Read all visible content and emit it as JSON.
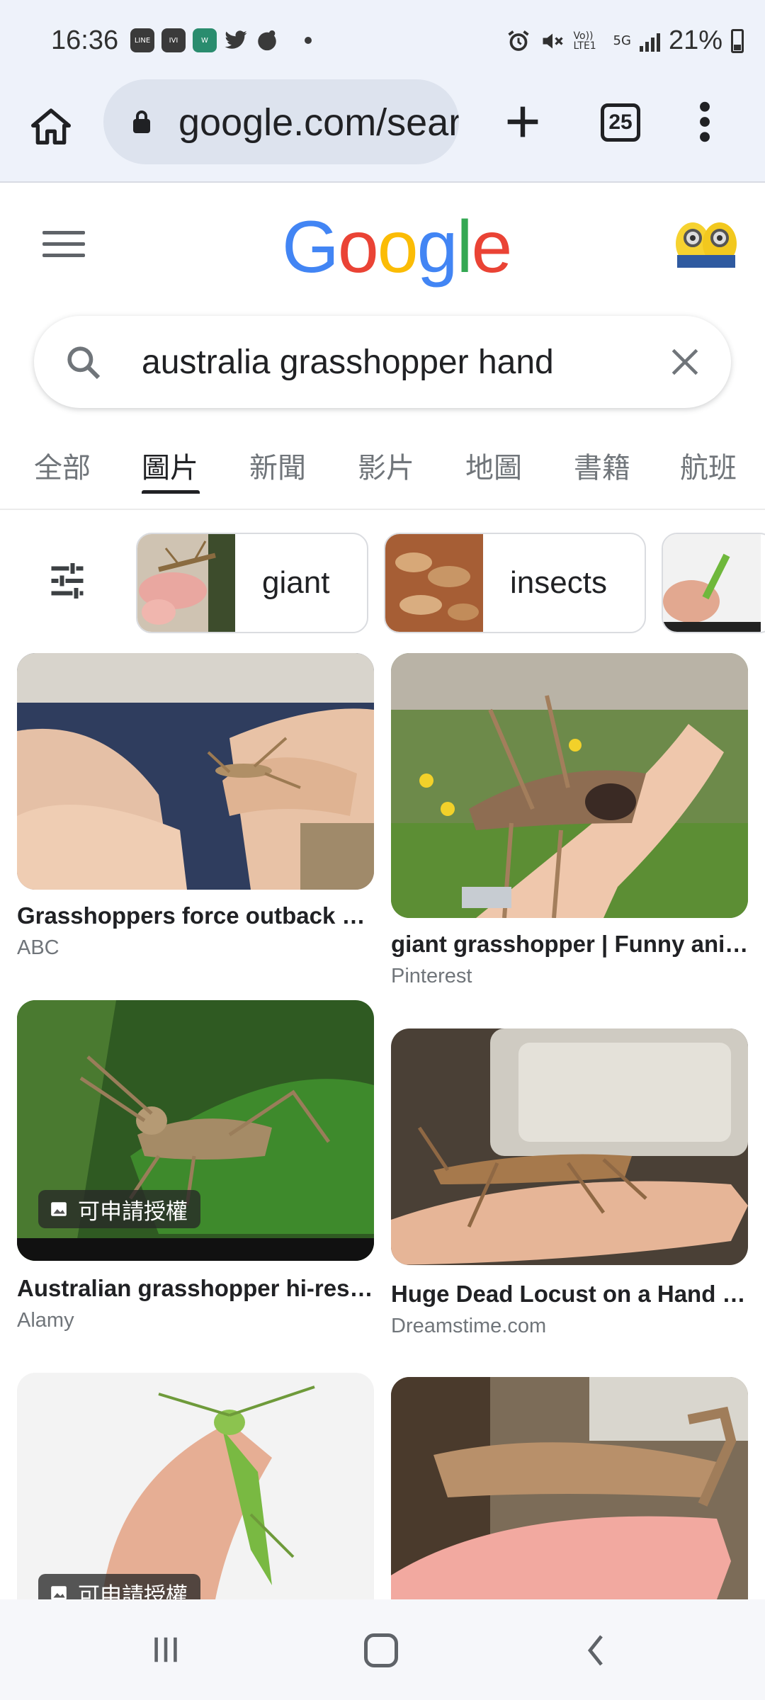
{
  "status_bar": {
    "time": "16:36",
    "app_icons": [
      "line-icon",
      "msg-app-icon",
      "webtoon-icon",
      "twitter-icon",
      "app-icon"
    ],
    "volte": "Vo)) LTE1",
    "network": "5G",
    "battery": "21%"
  },
  "browser": {
    "url": "google.com/search?q=australia",
    "tab_count": "25"
  },
  "google": {
    "logo_letters": [
      "G",
      "o",
      "o",
      "g",
      "l",
      "e"
    ],
    "logo_colors": [
      "#4285F4",
      "#EA4335",
      "#FBBC05",
      "#4285F4",
      "#34A853",
      "#EA4335"
    ]
  },
  "search": {
    "query": "australia grasshopper hand"
  },
  "tabs": [
    "全部",
    "圖片",
    "新聞",
    "影片",
    "地圖",
    "書籍",
    "航班"
  ],
  "active_tab": "圖片",
  "chips": [
    {
      "label": "giant"
    },
    {
      "label": "insects"
    },
    {
      "label": ""
    }
  ],
  "results": [
    {
      "title": "Grasshoppers force outback …",
      "source": "ABC",
      "badge": ""
    },
    {
      "title": "giant grasshopper | Funny ani…",
      "source": "Pinterest",
      "badge": ""
    },
    {
      "title": "Australian grasshopper hi-res…",
      "source": "Alamy",
      "badge": "可申請授權"
    },
    {
      "title": "Huge Dead Locust on a Hand …",
      "source": "Dreamstime.com",
      "badge": ""
    },
    {
      "title": "",
      "source": "",
      "badge": "可申請授權"
    },
    {
      "title": "",
      "source": "",
      "badge": ""
    }
  ]
}
